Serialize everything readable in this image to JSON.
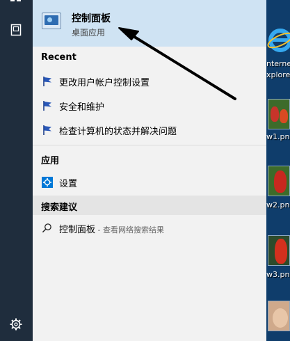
{
  "best_match": {
    "title": "控制面板",
    "subtitle": "桌面应用"
  },
  "recent": {
    "header": "Recent",
    "items": [
      {
        "label": "更改用户帐户控制设置"
      },
      {
        "label": "安全和维护"
      },
      {
        "label": "检查计算机的状态并解决问题"
      }
    ]
  },
  "apps": {
    "header": "应用",
    "items": [
      {
        "label": "设置"
      }
    ]
  },
  "suggestions": {
    "header": "搜索建议",
    "item": {
      "query": "控制面板",
      "hint": " - 查看网络搜索结果"
    }
  },
  "desktop": {
    "labels": [
      "nterne",
      "xplore",
      "w1.pn",
      "w2.pn",
      "w3.pn"
    ]
  },
  "colors": {
    "selected_bg": "#cfe3f3",
    "panel_bg": "#f2f2f2",
    "rail_bg": "#1f2d3d",
    "accent": "#0078d7"
  }
}
